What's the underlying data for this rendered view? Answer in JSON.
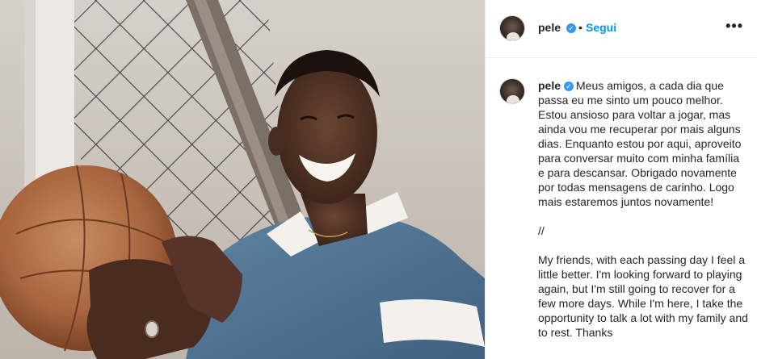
{
  "post": {
    "username": "pele",
    "verified_glyph": "✓",
    "separator": "•",
    "follow_label": "Segui",
    "more_label": "•••",
    "photo_alt": "Pelé smiling holding a leather football in front of a goal net",
    "caption": "Meus amigos, a cada dia que passa eu me sinto um pouco melhor. Estou ansioso para voltar a jogar, mas ainda vou me recuperar por mais alguns dias. Enquanto estou por aqui, aproveito para conversar muito com minha família e para descansar. Obrigado novamente por todas mensagens de carinho. Logo mais estaremos juntos novamente!\n\n//\n\nMy friends, with each passing day I feel a little better. I'm looking forward to playing again, but I'm still going to recover for a few more days. While I'm here, I take the opportunity to talk a lot with my family and to rest. Thanks"
  },
  "icons": {
    "verified": "verified-badge-icon",
    "more": "more-options-icon"
  },
  "colors": {
    "link_blue": "#0095f6",
    "verified_blue": "#3897f0",
    "text": "#262626",
    "border": "#efefef"
  }
}
